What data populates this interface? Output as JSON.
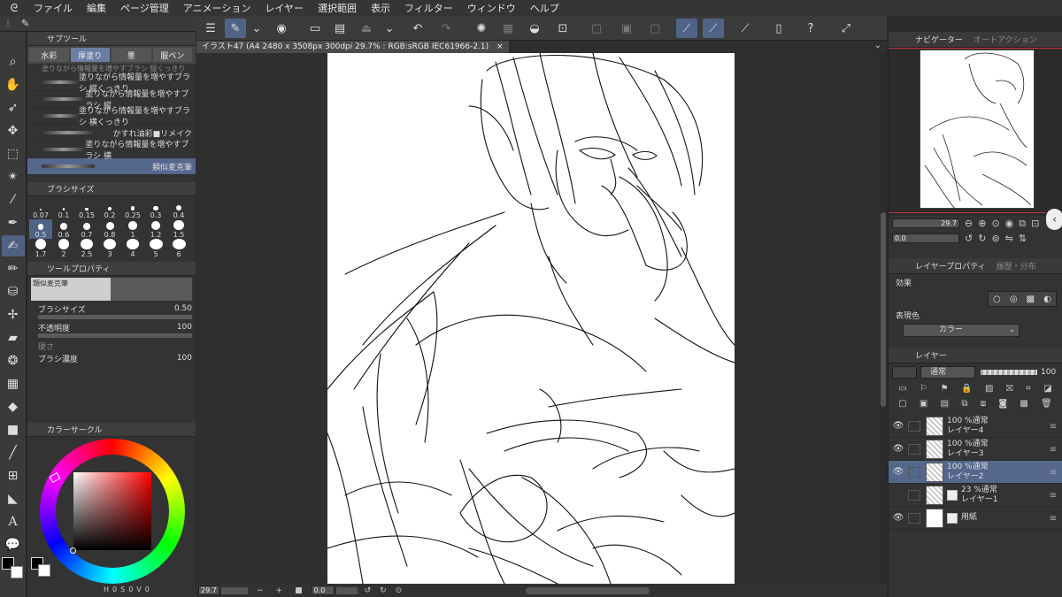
{
  "menubar": {
    "items": [
      "ファイル",
      "編集",
      "ページ管理",
      "アニメーション",
      "レイヤー",
      "選択範囲",
      "表示",
      "フィルター",
      "ウィンドウ",
      "ヘルプ"
    ]
  },
  "document": {
    "tab_title": "イラスト47 (A4 2480 x 3508px 300dpi 29.7% : RGB:sRGB IEC61966-2.1)",
    "close_glyph": "×"
  },
  "status": {
    "zoom": "29.7",
    "rotation": "0.0"
  },
  "subtool": {
    "title": "サブツール",
    "tabs": [
      "水彩",
      "厚塗り",
      "墨",
      "服ペン"
    ],
    "brushes": [
      "塗りながら情報量を増やすブラシ 縦くっきり",
      "塗りながら情報量を増やすブラシ 縦",
      "塗りながら情報量を増やすブラシ 横くっきり",
      "かすれ油彩■リメイク",
      "塗りながら情報量を増やすブラシ 横",
      "類似麦克筆"
    ],
    "selected_brush": "類似麦克筆"
  },
  "brush_size": {
    "title": "ブラシサイズ",
    "sizes": [
      "0.07",
      "0.1",
      "0.15",
      "0.2",
      "0.25",
      "0.3",
      "0.4",
      "0.5",
      "0.6",
      "0.7",
      "0.8",
      "1",
      "1.2",
      "1.5",
      "1.7",
      "2",
      "2.5",
      "3",
      "4",
      "5",
      "6"
    ],
    "selected": "0.5"
  },
  "tool_property": {
    "title": "ツールプロパティ",
    "brush_name": "類似麦克筆",
    "brush_size_label": "ブラシサイズ",
    "brush_size_value": "0.50",
    "opacity_label": "不透明度",
    "opacity_value": "100",
    "hardness_label": "硬さ",
    "density_label": "ブラシ濃度",
    "density_value": "100"
  },
  "color": {
    "title": "カラーサークル",
    "hsv_labels": [
      "H",
      "0",
      "S",
      "0",
      "V",
      "0"
    ],
    "wheel_value_pct": 0,
    "main_color": "#000000",
    "sub_color": "#ffffff"
  },
  "navigator": {
    "tabs": [
      "ナビゲーター",
      "オートアクション"
    ],
    "zoom": "29.7",
    "rotation": "0.0"
  },
  "layer_property": {
    "tabs": [
      "レイヤープロパティ",
      "履歴・分布"
    ],
    "effect_label": "効果",
    "expression_label": "表現色",
    "expression_value": "カラー"
  },
  "layer_panel": {
    "tab": "レイヤー",
    "blend_mode": "通常",
    "opacity": "100",
    "layers": [
      {
        "opacity_mode": "100 %通常",
        "name": "レイヤー4",
        "visible": true,
        "selected": false
      },
      {
        "opacity_mode": "100 %通常",
        "name": "レイヤー3",
        "visible": true,
        "selected": false
      },
      {
        "opacity_mode": "100 %通常",
        "name": "レイヤー2",
        "visible": true,
        "selected": true
      },
      {
        "opacity_mode": "23 %通常",
        "name": "レイヤー1",
        "visible": false,
        "selected": false
      },
      {
        "opacity_mode": "",
        "name": "用紙",
        "visible": true,
        "selected": false
      }
    ]
  }
}
